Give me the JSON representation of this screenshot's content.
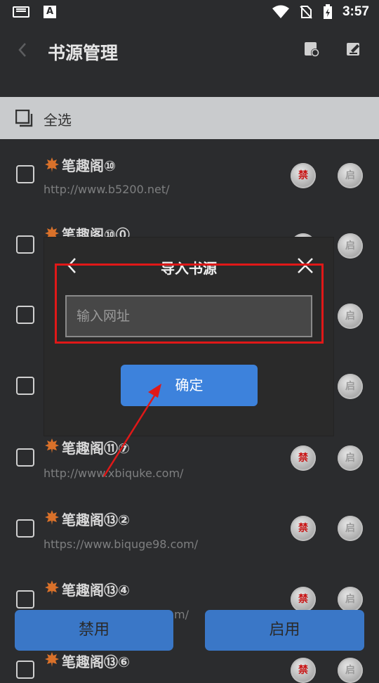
{
  "status": {
    "time": "3:57",
    "a_label": "A"
  },
  "toolbar": {
    "title": "书源管理"
  },
  "select_all": {
    "label": "全选"
  },
  "sources": [
    {
      "name": "笔趣阁⑩",
      "url": "http://www.b5200.net/"
    },
    {
      "name": "笔趣阁⑩⓪",
      "url": ""
    },
    {
      "name": "",
      "url": ""
    },
    {
      "name": "",
      "url": ""
    },
    {
      "name": "笔趣阁⑪⑦",
      "url": "http://www.xbiquke.com/"
    },
    {
      "name": "笔趣阁⑬②",
      "url": "https://www.biquge98.com/"
    },
    {
      "name": "笔趣阁⑬④",
      "url": "m/"
    },
    {
      "name": "笔趣阁⑬⑥",
      "url": ""
    }
  ],
  "badges": {
    "ban": "禁",
    "enable": "启"
  },
  "dialog": {
    "title": "导入书源",
    "input_placeholder": "输入网址",
    "confirm_label": "确定"
  },
  "bottom": {
    "disable_label": "禁用",
    "enable_label": "启用"
  },
  "colors": {
    "accent": "#3d82dc",
    "highlight": "#e01818",
    "background": "#2b2c2e"
  }
}
